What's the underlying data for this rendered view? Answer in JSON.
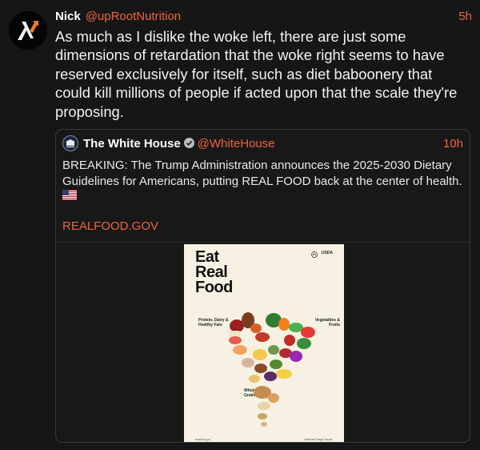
{
  "tweet": {
    "author_name": "Nick",
    "author_handle": "@upRootNutrition",
    "time": "5h",
    "avatar_icon": "half-life-lambda-logo",
    "text": "As much as I dislike the woke left, there are just some dimensions of retardation that the woke right seems to have reserved exclusively for itself, such as diet baboonery that could kill millions of people if acted upon that the scale they're proposing."
  },
  "quote": {
    "author_name": "The White House",
    "author_handle": "@WhiteHouse",
    "time": "10h",
    "verified": true,
    "text": "BREAKING: The Trump Administration announces the 2025-2030 Dietary Guidelines for Americans, putting REAL FOOD back at the center of health.",
    "flag_icon": "us-flag-emoji",
    "link_text": "REALFOOD.GOV"
  },
  "poster": {
    "title_lines": [
      "Eat",
      "Real",
      "Food"
    ],
    "usda": "USDA",
    "label_protein": "Protein, Dairy & Healthy Fats",
    "label_veg": "Vegetables & Fruits",
    "label_grains": "Whole Grains",
    "footer_left": "realfood.gov",
    "footer_right": "National Design Studio"
  },
  "colors": {
    "background": "#161616",
    "accent": "#f0643c",
    "text": "#f2f2f2",
    "border": "#3a3a3a"
  }
}
